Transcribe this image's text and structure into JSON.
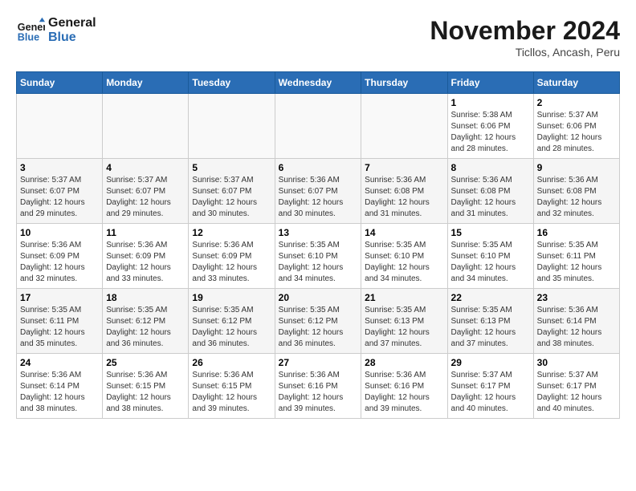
{
  "logo": {
    "line1": "General",
    "line2": "Blue"
  },
  "title": "November 2024",
  "subtitle": "Ticllos, Ancash, Peru",
  "weekdays": [
    "Sunday",
    "Monday",
    "Tuesday",
    "Wednesday",
    "Thursday",
    "Friday",
    "Saturday"
  ],
  "weeks": [
    [
      {
        "day": "",
        "info": ""
      },
      {
        "day": "",
        "info": ""
      },
      {
        "day": "",
        "info": ""
      },
      {
        "day": "",
        "info": ""
      },
      {
        "day": "",
        "info": ""
      },
      {
        "day": "1",
        "info": "Sunrise: 5:38 AM\nSunset: 6:06 PM\nDaylight: 12 hours and 28 minutes."
      },
      {
        "day": "2",
        "info": "Sunrise: 5:37 AM\nSunset: 6:06 PM\nDaylight: 12 hours and 28 minutes."
      }
    ],
    [
      {
        "day": "3",
        "info": "Sunrise: 5:37 AM\nSunset: 6:07 PM\nDaylight: 12 hours and 29 minutes."
      },
      {
        "day": "4",
        "info": "Sunrise: 5:37 AM\nSunset: 6:07 PM\nDaylight: 12 hours and 29 minutes."
      },
      {
        "day": "5",
        "info": "Sunrise: 5:37 AM\nSunset: 6:07 PM\nDaylight: 12 hours and 30 minutes."
      },
      {
        "day": "6",
        "info": "Sunrise: 5:36 AM\nSunset: 6:07 PM\nDaylight: 12 hours and 30 minutes."
      },
      {
        "day": "7",
        "info": "Sunrise: 5:36 AM\nSunset: 6:08 PM\nDaylight: 12 hours and 31 minutes."
      },
      {
        "day": "8",
        "info": "Sunrise: 5:36 AM\nSunset: 6:08 PM\nDaylight: 12 hours and 31 minutes."
      },
      {
        "day": "9",
        "info": "Sunrise: 5:36 AM\nSunset: 6:08 PM\nDaylight: 12 hours and 32 minutes."
      }
    ],
    [
      {
        "day": "10",
        "info": "Sunrise: 5:36 AM\nSunset: 6:09 PM\nDaylight: 12 hours and 32 minutes."
      },
      {
        "day": "11",
        "info": "Sunrise: 5:36 AM\nSunset: 6:09 PM\nDaylight: 12 hours and 33 minutes."
      },
      {
        "day": "12",
        "info": "Sunrise: 5:36 AM\nSunset: 6:09 PM\nDaylight: 12 hours and 33 minutes."
      },
      {
        "day": "13",
        "info": "Sunrise: 5:35 AM\nSunset: 6:10 PM\nDaylight: 12 hours and 34 minutes."
      },
      {
        "day": "14",
        "info": "Sunrise: 5:35 AM\nSunset: 6:10 PM\nDaylight: 12 hours and 34 minutes."
      },
      {
        "day": "15",
        "info": "Sunrise: 5:35 AM\nSunset: 6:10 PM\nDaylight: 12 hours and 34 minutes."
      },
      {
        "day": "16",
        "info": "Sunrise: 5:35 AM\nSunset: 6:11 PM\nDaylight: 12 hours and 35 minutes."
      }
    ],
    [
      {
        "day": "17",
        "info": "Sunrise: 5:35 AM\nSunset: 6:11 PM\nDaylight: 12 hours and 35 minutes."
      },
      {
        "day": "18",
        "info": "Sunrise: 5:35 AM\nSunset: 6:12 PM\nDaylight: 12 hours and 36 minutes."
      },
      {
        "day": "19",
        "info": "Sunrise: 5:35 AM\nSunset: 6:12 PM\nDaylight: 12 hours and 36 minutes."
      },
      {
        "day": "20",
        "info": "Sunrise: 5:35 AM\nSunset: 6:12 PM\nDaylight: 12 hours and 36 minutes."
      },
      {
        "day": "21",
        "info": "Sunrise: 5:35 AM\nSunset: 6:13 PM\nDaylight: 12 hours and 37 minutes."
      },
      {
        "day": "22",
        "info": "Sunrise: 5:35 AM\nSunset: 6:13 PM\nDaylight: 12 hours and 37 minutes."
      },
      {
        "day": "23",
        "info": "Sunrise: 5:36 AM\nSunset: 6:14 PM\nDaylight: 12 hours and 38 minutes."
      }
    ],
    [
      {
        "day": "24",
        "info": "Sunrise: 5:36 AM\nSunset: 6:14 PM\nDaylight: 12 hours and 38 minutes."
      },
      {
        "day": "25",
        "info": "Sunrise: 5:36 AM\nSunset: 6:15 PM\nDaylight: 12 hours and 38 minutes."
      },
      {
        "day": "26",
        "info": "Sunrise: 5:36 AM\nSunset: 6:15 PM\nDaylight: 12 hours and 39 minutes."
      },
      {
        "day": "27",
        "info": "Sunrise: 5:36 AM\nSunset: 6:16 PM\nDaylight: 12 hours and 39 minutes."
      },
      {
        "day": "28",
        "info": "Sunrise: 5:36 AM\nSunset: 6:16 PM\nDaylight: 12 hours and 39 minutes."
      },
      {
        "day": "29",
        "info": "Sunrise: 5:37 AM\nSunset: 6:17 PM\nDaylight: 12 hours and 40 minutes."
      },
      {
        "day": "30",
        "info": "Sunrise: 5:37 AM\nSunset: 6:17 PM\nDaylight: 12 hours and 40 minutes."
      }
    ]
  ]
}
